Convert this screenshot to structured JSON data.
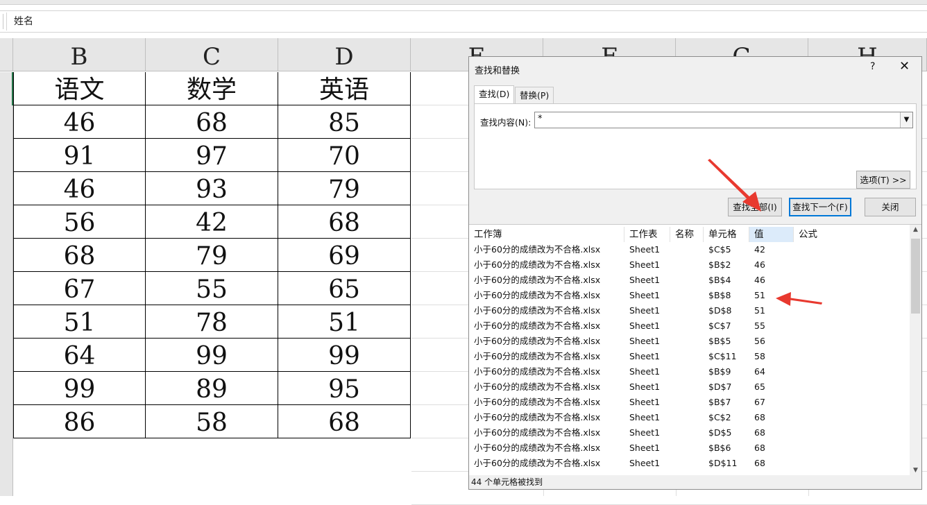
{
  "formula_bar": {
    "content": "姓名"
  },
  "columns": [
    "B",
    "C",
    "D",
    "E",
    "F",
    "G",
    "H"
  ],
  "sheet": {
    "header_row": [
      "语文",
      "数学",
      "英语"
    ],
    "rows": [
      [
        "46",
        "68",
        "85"
      ],
      [
        "91",
        "97",
        "70"
      ],
      [
        "46",
        "93",
        "79"
      ],
      [
        "56",
        "42",
        "68"
      ],
      [
        "68",
        "79",
        "69"
      ],
      [
        "67",
        "55",
        "65"
      ],
      [
        "51",
        "78",
        "51"
      ],
      [
        "64",
        "99",
        "99"
      ],
      [
        "99",
        "89",
        "95"
      ],
      [
        "86",
        "58",
        "68"
      ]
    ]
  },
  "dialog": {
    "title": "查找和替换",
    "help": "?",
    "close": "✕",
    "tabs": [
      "查找(D)",
      "替换(P)"
    ],
    "find_label": "查找内容(N):",
    "find_value": "*",
    "dropdown_icon": "chevron-down",
    "options_button": "选项(T) >>",
    "find_all_button": "查找全部(I)",
    "find_next_button": "查找下一个(F)",
    "close_button": "关闭",
    "results_headers": [
      "工作簿",
      "工作表",
      "名称",
      "单元格",
      "值",
      "公式"
    ],
    "results": [
      [
        "小于60分的成绩改为不合格.xlsx",
        "Sheet1",
        "",
        "$C$5",
        "42"
      ],
      [
        "小于60分的成绩改为不合格.xlsx",
        "Sheet1",
        "",
        "$B$2",
        "46"
      ],
      [
        "小于60分的成绩改为不合格.xlsx",
        "Sheet1",
        "",
        "$B$4",
        "46"
      ],
      [
        "小于60分的成绩改为不合格.xlsx",
        "Sheet1",
        "",
        "$B$8",
        "51"
      ],
      [
        "小于60分的成绩改为不合格.xlsx",
        "Sheet1",
        "",
        "$D$8",
        "51"
      ],
      [
        "小于60分的成绩改为不合格.xlsx",
        "Sheet1",
        "",
        "$C$7",
        "55"
      ],
      [
        "小于60分的成绩改为不合格.xlsx",
        "Sheet1",
        "",
        "$B$5",
        "56"
      ],
      [
        "小于60分的成绩改为不合格.xlsx",
        "Sheet1",
        "",
        "$C$11",
        "58"
      ],
      [
        "小于60分的成绩改为不合格.xlsx",
        "Sheet1",
        "",
        "$B$9",
        "64"
      ],
      [
        "小于60分的成绩改为不合格.xlsx",
        "Sheet1",
        "",
        "$D$7",
        "65"
      ],
      [
        "小于60分的成绩改为不合格.xlsx",
        "Sheet1",
        "",
        "$B$7",
        "67"
      ],
      [
        "小于60分的成绩改为不合格.xlsx",
        "Sheet1",
        "",
        "$C$2",
        "68"
      ],
      [
        "小于60分的成绩改为不合格.xlsx",
        "Sheet1",
        "",
        "$D$5",
        "68"
      ],
      [
        "小于60分的成绩改为不合格.xlsx",
        "Sheet1",
        "",
        "$B$6",
        "68"
      ],
      [
        "小于60分的成绩改为不合格.xlsx",
        "Sheet1",
        "",
        "$D$11",
        "68"
      ]
    ],
    "status": "44 个单元格被找到"
  },
  "colors": {
    "annotation_arrow": "#e8392f",
    "selection": "#217346",
    "sorted_header": "#dcebfa"
  }
}
